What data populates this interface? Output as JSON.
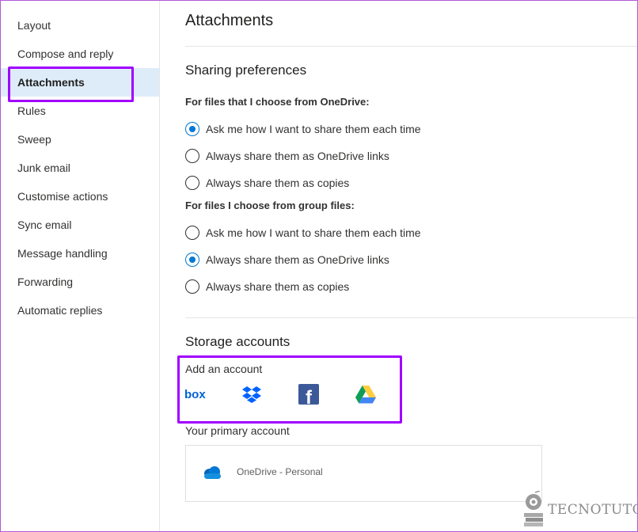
{
  "sidebar": {
    "items": [
      {
        "label": "Layout"
      },
      {
        "label": "Compose and reply"
      },
      {
        "label": "Attachments"
      },
      {
        "label": "Rules"
      },
      {
        "label": "Sweep"
      },
      {
        "label": "Junk email"
      },
      {
        "label": "Customise actions"
      },
      {
        "label": "Sync email"
      },
      {
        "label": "Message handling"
      },
      {
        "label": "Forwarding"
      },
      {
        "label": "Automatic replies"
      }
    ],
    "selected": "Attachments"
  },
  "main": {
    "title": "Attachments",
    "sharing": {
      "title": "Sharing preferences",
      "onedrive": {
        "label": "For files that I choose from OneDrive:",
        "options": [
          {
            "label": "Ask me how I want to share them each time",
            "checked": true
          },
          {
            "label": "Always share them as OneDrive links",
            "checked": false
          },
          {
            "label": "Always share them as copies",
            "checked": false
          }
        ]
      },
      "group": {
        "label": "For files I choose from group files:",
        "options": [
          {
            "label": "Ask me how I want to share them each time",
            "checked": false
          },
          {
            "label": "Always share them as OneDrive links",
            "checked": true
          },
          {
            "label": "Always share them as copies",
            "checked": false
          }
        ]
      }
    },
    "storage": {
      "title": "Storage accounts",
      "add_label": "Add an account",
      "providers": [
        {
          "name": "box-icon",
          "text": "box",
          "color": "#0061d5"
        },
        {
          "name": "dropbox-icon",
          "color": "#0061fe"
        },
        {
          "name": "facebook-icon",
          "text": "f",
          "color": "#3b5998"
        },
        {
          "name": "google-drive-icon",
          "colors": [
            "#0f9d58",
            "#ffcd40",
            "#4285f4"
          ]
        }
      ],
      "primary_label": "Your primary account",
      "primary_account": "OneDrive - Personal",
      "onedrive_color": "#0364b8"
    }
  },
  "watermark": "TECNOTUTO",
  "colors": {
    "accent": "#0078d4",
    "highlight": "#a100ff",
    "selected_bg": "#deecf9"
  }
}
